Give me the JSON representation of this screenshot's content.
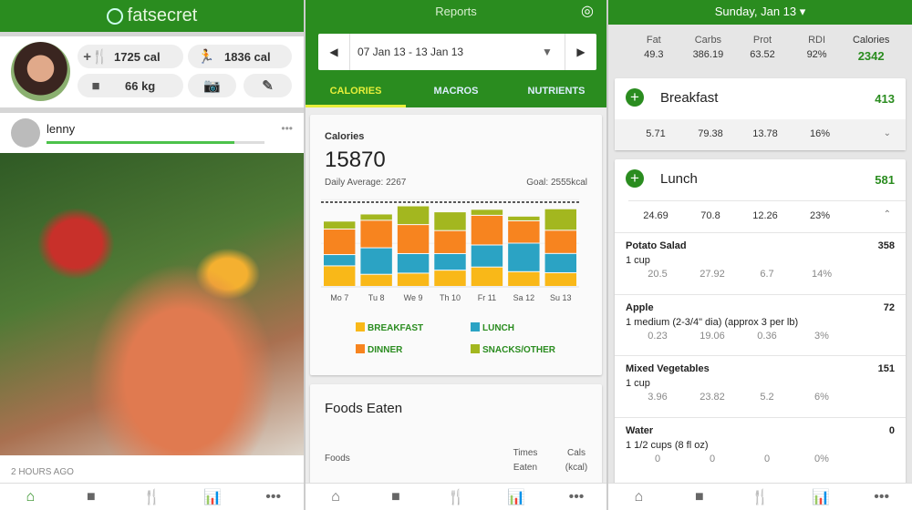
{
  "feed": {
    "app_title": "fatsecret",
    "food_cal": "1725 cal",
    "exercise_cal": "1836 cal",
    "weight": "66 kg",
    "post": {
      "user": "lenny",
      "progress": 0.86,
      "time": "2 HOURS AGO"
    }
  },
  "reports": {
    "title": "Reports",
    "date_range": "07 Jan 13 - 13 Jan 13",
    "tabs": [
      {
        "label": "CALORIES",
        "active": true
      },
      {
        "label": "MACROS"
      },
      {
        "label": "NUTRIENTS"
      }
    ],
    "card_label": "Calories",
    "total": "15870",
    "daily_average": "Daily Average: 2267",
    "goal": "Goal: 2555kcal",
    "foods_eaten": {
      "title": "Foods Eaten",
      "col_foods": "Foods",
      "col_times": "Times Eaten",
      "col_cals": "Cals (kcal)"
    }
  },
  "chart_data": {
    "type": "bar",
    "stacked": true,
    "categories": [
      "Mo 7",
      "Tu 8",
      "We 9",
      "Th 10",
      "Fr 11",
      "Sa 12",
      "Su 13"
    ],
    "goal": 2555,
    "ylim": [
      0,
      2700
    ],
    "grid": true,
    "legend_placement": "bottom",
    "series": [
      {
        "name": "BREAKFAST",
        "color": "#f9b818",
        "values": [
          620,
          365,
          400,
          490,
          585,
          445,
          413
        ]
      },
      {
        "name": "LUNCH",
        "color": "#2ba3c4",
        "values": [
          340,
          800,
          590,
          500,
          665,
          860,
          581
        ]
      },
      {
        "name": "DINNER",
        "color": "#f7841f",
        "values": [
          770,
          830,
          875,
          695,
          895,
          675,
          700
        ]
      },
      {
        "name": "SNACKS/OTHER",
        "color": "#a3b71f",
        "values": [
          240,
          190,
          565,
          565,
          180,
          140,
          648
        ]
      }
    ]
  },
  "diary": {
    "date": "Sunday, Jan 13 ▾",
    "headers": [
      "Fat",
      "Carbs",
      "Prot",
      "RDI",
      "Calories"
    ],
    "totals": [
      "49.3",
      "386.19",
      "63.52",
      "92%",
      "2342"
    ],
    "breakfast": {
      "name": "Breakfast",
      "cal": "413",
      "macros": [
        "5.71",
        "79.38",
        "13.78",
        "16%"
      ]
    },
    "lunch": {
      "name": "Lunch",
      "cal": "581",
      "macros": [
        "24.69",
        "70.8",
        "12.26",
        "23%"
      ],
      "items": [
        {
          "name": "Potato Salad",
          "cal": "358",
          "portion": "1 cup",
          "macros": [
            "20.5",
            "27.92",
            "6.7",
            "14%"
          ]
        },
        {
          "name": "Apple",
          "cal": "72",
          "portion": "1 medium (2-3/4\" dia) (approx 3 per lb)",
          "macros": [
            "0.23",
            "19.06",
            "0.36",
            "3%"
          ]
        },
        {
          "name": "Mixed Vegetables",
          "cal": "151",
          "portion": "1 cup",
          "macros": [
            "3.96",
            "23.82",
            "5.2",
            "6%"
          ]
        },
        {
          "name": "Water",
          "cal": "0",
          "portion": "1 1/2 cups (8 fl oz)",
          "macros": [
            "0",
            "0",
            "0",
            "0%"
          ]
        }
      ]
    }
  },
  "accent": "#2a8c1f"
}
